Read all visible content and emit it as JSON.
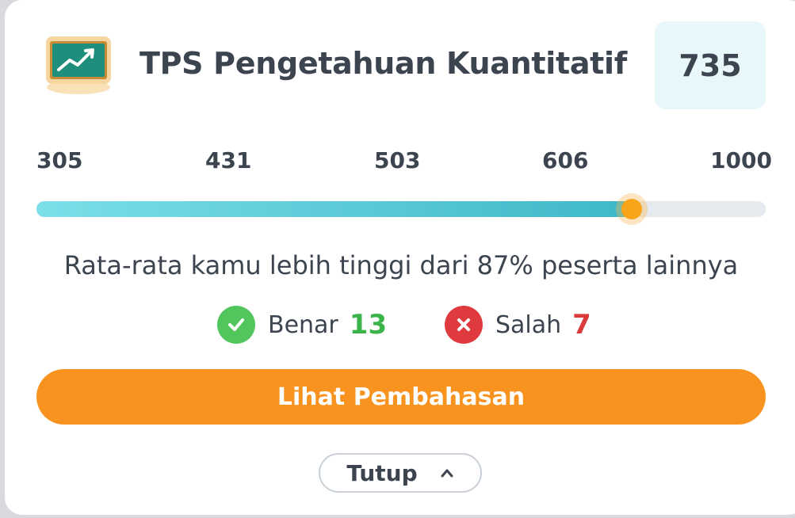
{
  "card": {
    "icon": "chalkboard-chart-icon",
    "title": "TPS Pengetahuan Kuantitatif",
    "score": "735"
  },
  "scale": {
    "ticks": [
      "305",
      "431",
      "503",
      "606",
      "1000"
    ],
    "min": 0,
    "max": 1000,
    "progress_fraction": 0.816
  },
  "summary": {
    "text": "Rata-rata kamu lebih tinggi dari 87% peserta lainnya"
  },
  "stats": {
    "correct": {
      "icon": "check-circle-icon",
      "label": "Benar",
      "value": "13",
      "color": "#3bb54a"
    },
    "wrong": {
      "icon": "x-circle-icon",
      "label": "Salah",
      "value": "7",
      "color": "#d93b3b"
    }
  },
  "actions": {
    "primary_label": "Lihat Pembahasan",
    "close_label": "Tutup",
    "close_icon": "chevron-up-icon"
  },
  "colors": {
    "accent": "#f7931e",
    "progress": "#3fb8c6",
    "score_bg": "#e8f7fa",
    "text": "#3c4450"
  }
}
